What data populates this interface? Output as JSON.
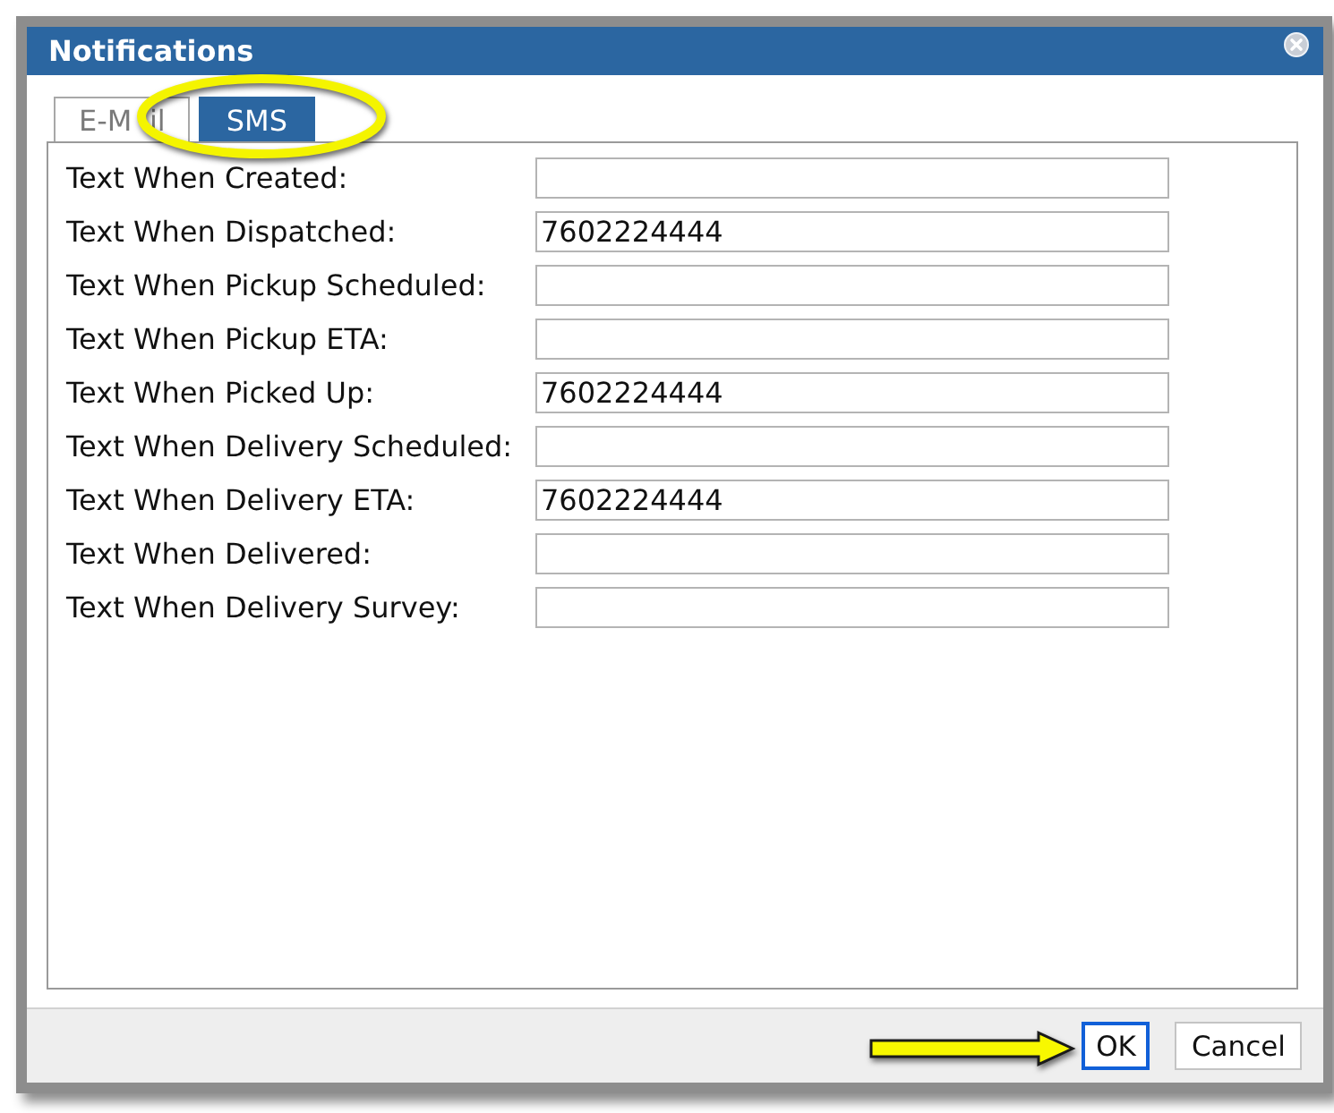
{
  "window": {
    "title": "Notifications"
  },
  "tabs": [
    {
      "label": "E-M il",
      "selected": false,
      "circled": false
    },
    {
      "label": "SMS",
      "selected": true,
      "circled": true
    }
  ],
  "fields": [
    {
      "label": "Text When Created:"
    },
    {
      "label": "Text When Dispatched:",
      "value": "7602224444"
    },
    {
      "label": "Text When Pickup Scheduled:"
    },
    {
      "label": "Text When Pickup ETA:"
    },
    {
      "label": "Text When Picked Up:",
      "value": "7602224444"
    },
    {
      "label": "Text When Delivery Scheduled:"
    },
    {
      "label": "Text When Delivery ETA:",
      "value": "7602224444"
    },
    {
      "label": "Text When Delivered:"
    },
    {
      "label": "Text When Delivery Survey:"
    }
  ],
  "buttons": [
    {
      "label": "OK",
      "focused": true,
      "pointed_at": true
    },
    {
      "label": "Cancel",
      "focused": false,
      "pointed_at": false
    }
  ]
}
